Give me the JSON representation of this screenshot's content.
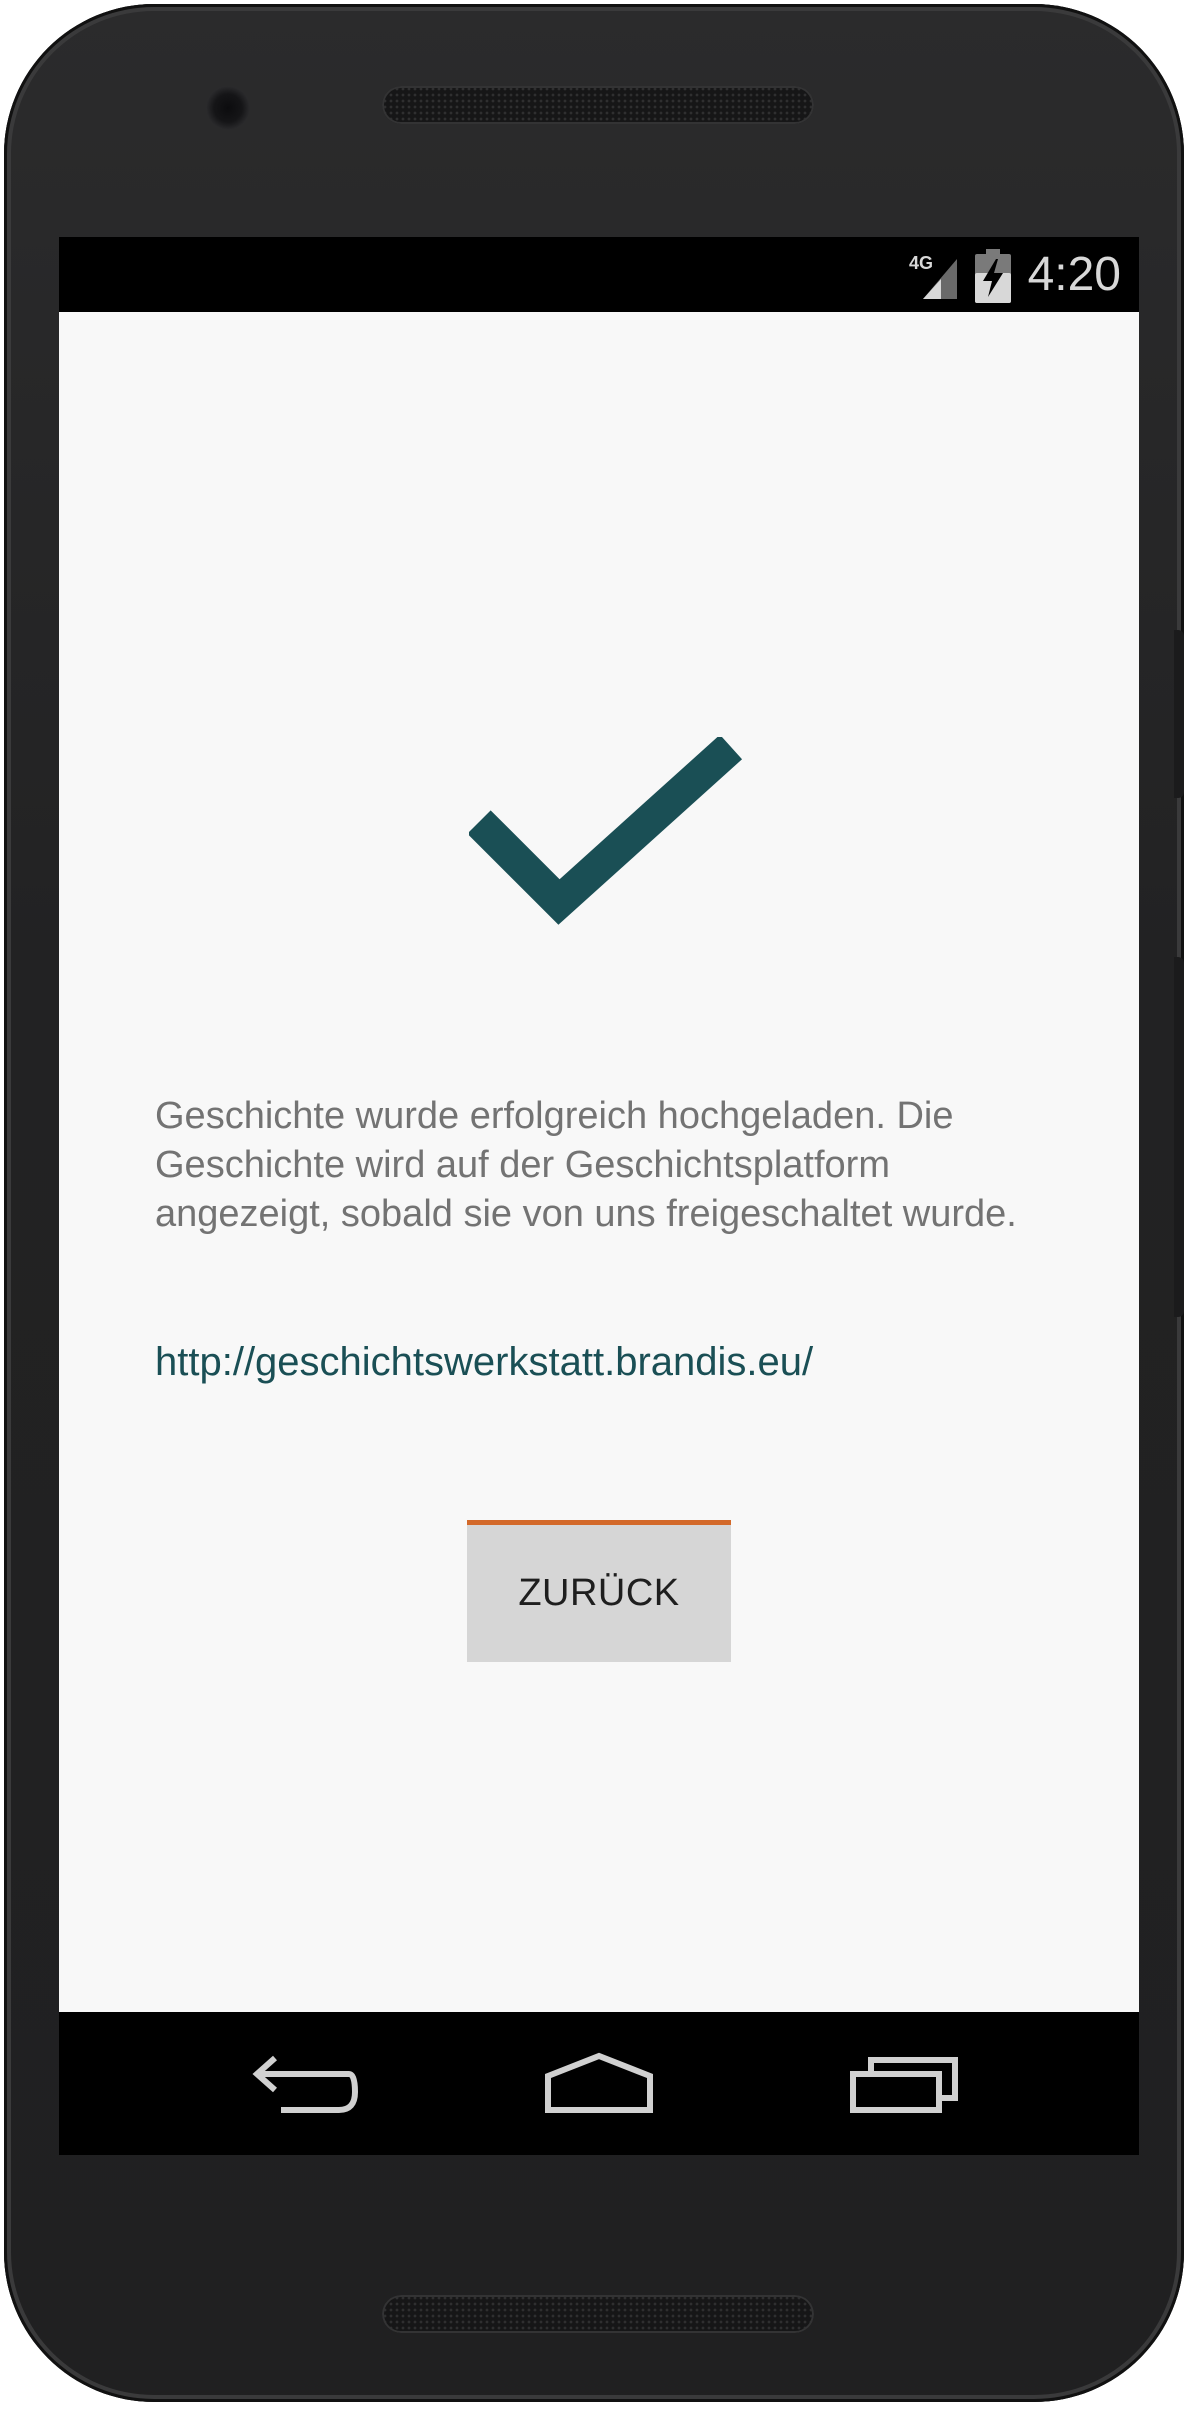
{
  "status_bar": {
    "network_type": "4G",
    "time": "4:20",
    "icons": [
      "signal-icon",
      "battery-icon"
    ]
  },
  "main": {
    "success_icon": "checkmark-icon",
    "message": "Geschichte wurde erfolgreich hochgeladen. Die Geschichte wird auf der Geschichtsplatform angezeigt, sobald sie von uns freigeschaltet wurde.",
    "link": "http://geschichtswerkstatt.brandis.eu/",
    "back_button_label": "ZURÜCK"
  },
  "nav_bar": {
    "icons": [
      "back-icon",
      "home-icon",
      "recents-icon"
    ]
  },
  "colors": {
    "accent": "#1a4f55",
    "button_indicator": "#d3692a",
    "button_background": "#d6d6d6",
    "screen_background": "#f8f8f8"
  }
}
